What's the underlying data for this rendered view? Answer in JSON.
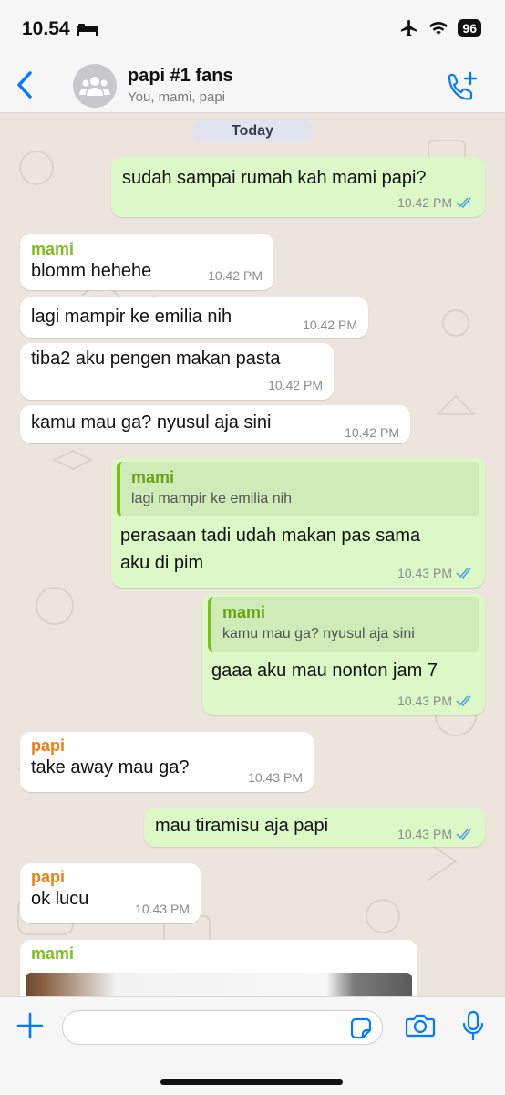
{
  "status": {
    "time": "10.54",
    "battery": "96"
  },
  "header": {
    "title": "papi #1 fans",
    "subtitle": "You, mami, papi"
  },
  "chat": {
    "date_label": "Today",
    "messages": [
      {
        "text": "sudah sampai rumah kah mami papi?",
        "time": "10.42 PM"
      },
      {
        "sender": "mami",
        "text": "blomm hehehe",
        "time": "10.42 PM"
      },
      {
        "text": "lagi mampir ke emilia nih",
        "time": "10.42 PM"
      },
      {
        "text": "tiba2 aku pengen makan pasta",
        "time": "10.42 PM"
      },
      {
        "text": "kamu mau ga? nyusul aja sini",
        "time": "10.42 PM"
      },
      {
        "quote_author": "mami",
        "quote_text": "lagi mampir ke emilia nih",
        "text_line1": "perasaan tadi udah makan pas sama",
        "text_line2": "aku di pim",
        "time": "10.43 PM"
      },
      {
        "quote_author": "mami",
        "quote_text": "kamu mau ga? nyusul aja sini",
        "text": "gaaa aku mau nonton jam 7",
        "time": "10.43 PM"
      },
      {
        "sender": "papi",
        "text": "take away mau ga?",
        "time": "10.43 PM"
      },
      {
        "text": "mau tiramisu aja papi",
        "time": "10.43 PM"
      },
      {
        "sender": "papi",
        "text": "ok lucu",
        "time": "10.43 PM"
      },
      {
        "sender": "mami"
      }
    ]
  },
  "input": {
    "placeholder": ""
  },
  "colors": {
    "mami": "#7cbf1c",
    "papi": "#f07d12",
    "accent": "#007aff",
    "outgoing": "#dcf8c6",
    "tick": "#4fa3e0"
  }
}
